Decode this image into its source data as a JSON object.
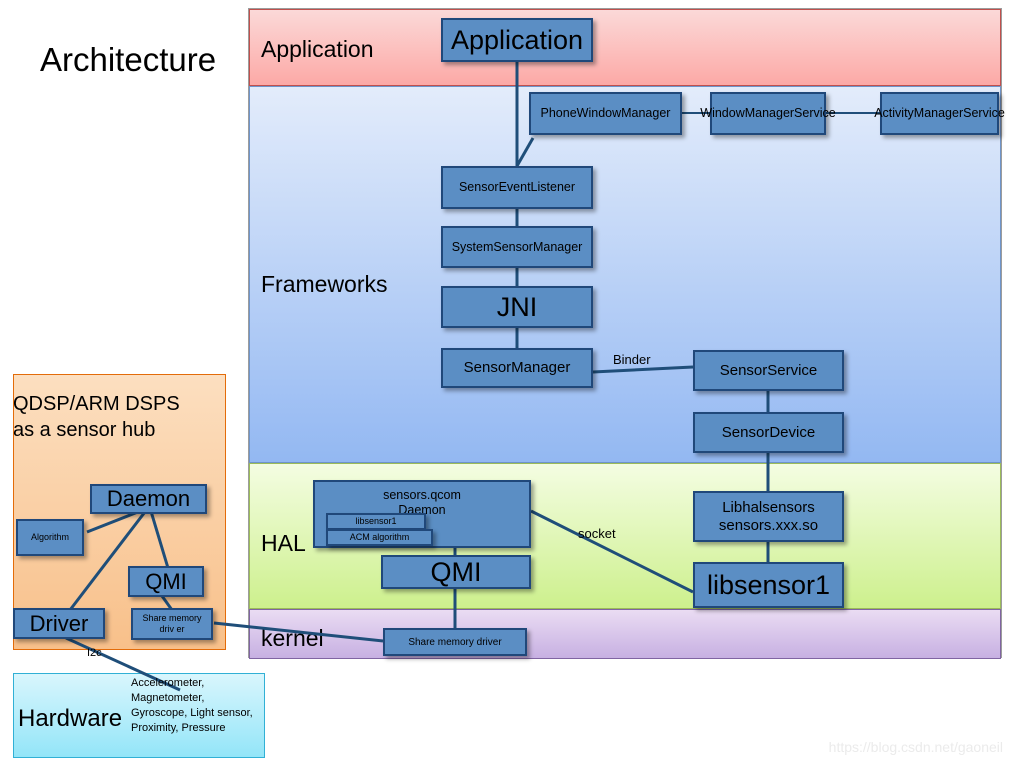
{
  "slide": {
    "title": "Architecture",
    "watermark": "https://blog.csdn.net/gaoneil"
  },
  "layers": [
    {
      "id": "application",
      "label": "Application",
      "color": "#fca9a6"
    },
    {
      "id": "frameworks",
      "label": "Frameworks",
      "color": "#93b8f2"
    },
    {
      "id": "hal",
      "label": "HAL",
      "color": "#cdf08d"
    },
    {
      "id": "kernel",
      "label": "kernel",
      "color": "#c7b0e2"
    }
  ],
  "nodes": {
    "application": "Application",
    "phone_window_manager": "PhoneWindowManager",
    "window_manager_service": "WindowManagerService",
    "activity_manager_service": "ActivityManagerService",
    "sensor_event_listener": "SensorEventListener",
    "system_sensor_manager": "SystemSensorManager",
    "jni": "JNI",
    "sensor_manager": "SensorManager",
    "sensor_service": "SensorService",
    "sensor_device": "SensorDevice",
    "sensors_qcom_daemon": "sensors.qcom\nDaemon",
    "libsensor1_nested": "libsensor1",
    "acm_algorithm": "ACM algorithm",
    "qmi_hal": "QMI",
    "libhalsensors": "Libhalsensors\nsensors.xxx.so",
    "libsensor1": "libsensor1",
    "share_memory_driver_kernel": "Share memory  driver"
  },
  "edge_labels": {
    "binder": "Binder",
    "socket": "socket",
    "i2c": "I2c"
  },
  "qdsp": {
    "title": "QDSP/ARM DSPS as a sensor hub",
    "nodes": {
      "daemon": "Daemon",
      "algorithm": "Algorithm",
      "qmi": "QMI",
      "share_memory_driver": "Share memory\ndriv er"
    }
  },
  "hardware": {
    "label": "Hardware",
    "sensors": "Accelerometer, Magnetometer, Gyroscope, Light sensor, Proximity, Pressure"
  },
  "colors": {
    "node_fill": "#5b8ec4",
    "node_border": "#20487a",
    "wire": "#1f4e79",
    "application_band": "#fca9a6",
    "frameworks_band": "#93b8f2",
    "hal_band": "#cdf08d",
    "kernel_band": "#c7b0e2",
    "qdsp_panel": "#f8c08a",
    "hardware_panel": "#93e5f8"
  }
}
